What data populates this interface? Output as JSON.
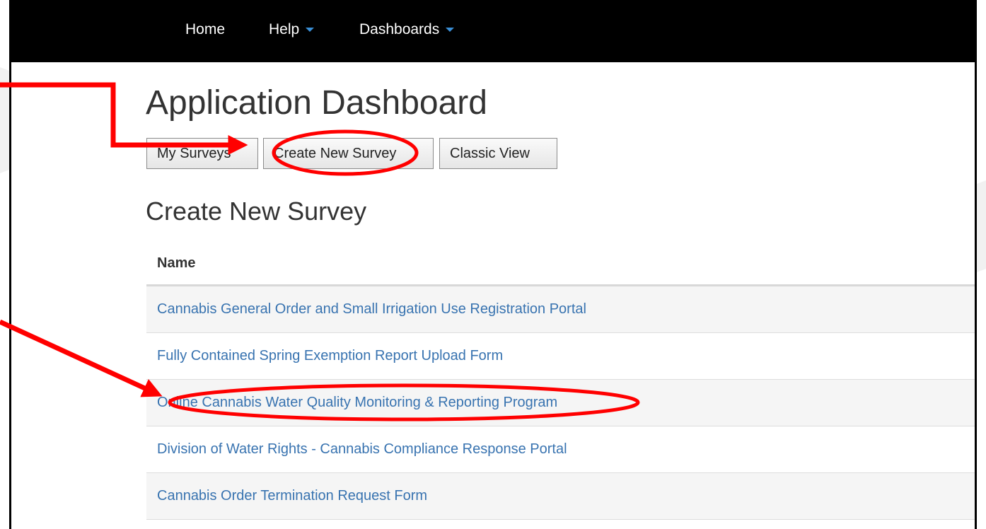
{
  "nav": {
    "items": [
      {
        "label": "Home",
        "has_caret": false
      },
      {
        "label": "Help",
        "has_caret": true
      },
      {
        "label": "Dashboards",
        "has_caret": true
      }
    ]
  },
  "page": {
    "title": "Application Dashboard",
    "buttons": [
      {
        "label": "My Surveys"
      },
      {
        "label": "Create New Survey"
      },
      {
        "label": "Classic View"
      }
    ],
    "section_title": "Create New Survey"
  },
  "table": {
    "header": "Name",
    "rows": [
      "Cannabis General Order and Small Irrigation Use Registration Portal",
      "Fully Contained Spring Exemption Report Upload Form",
      "Online Cannabis Water Quality Monitoring & Reporting Program",
      "Division of Water Rights - Cannabis Compliance Response Portal",
      "Cannabis Order Termination Request Form"
    ]
  },
  "colors": {
    "navbar": "#000000",
    "link": "#3873b0",
    "caret": "#3a8fd6",
    "annotation": "#ff0000"
  }
}
